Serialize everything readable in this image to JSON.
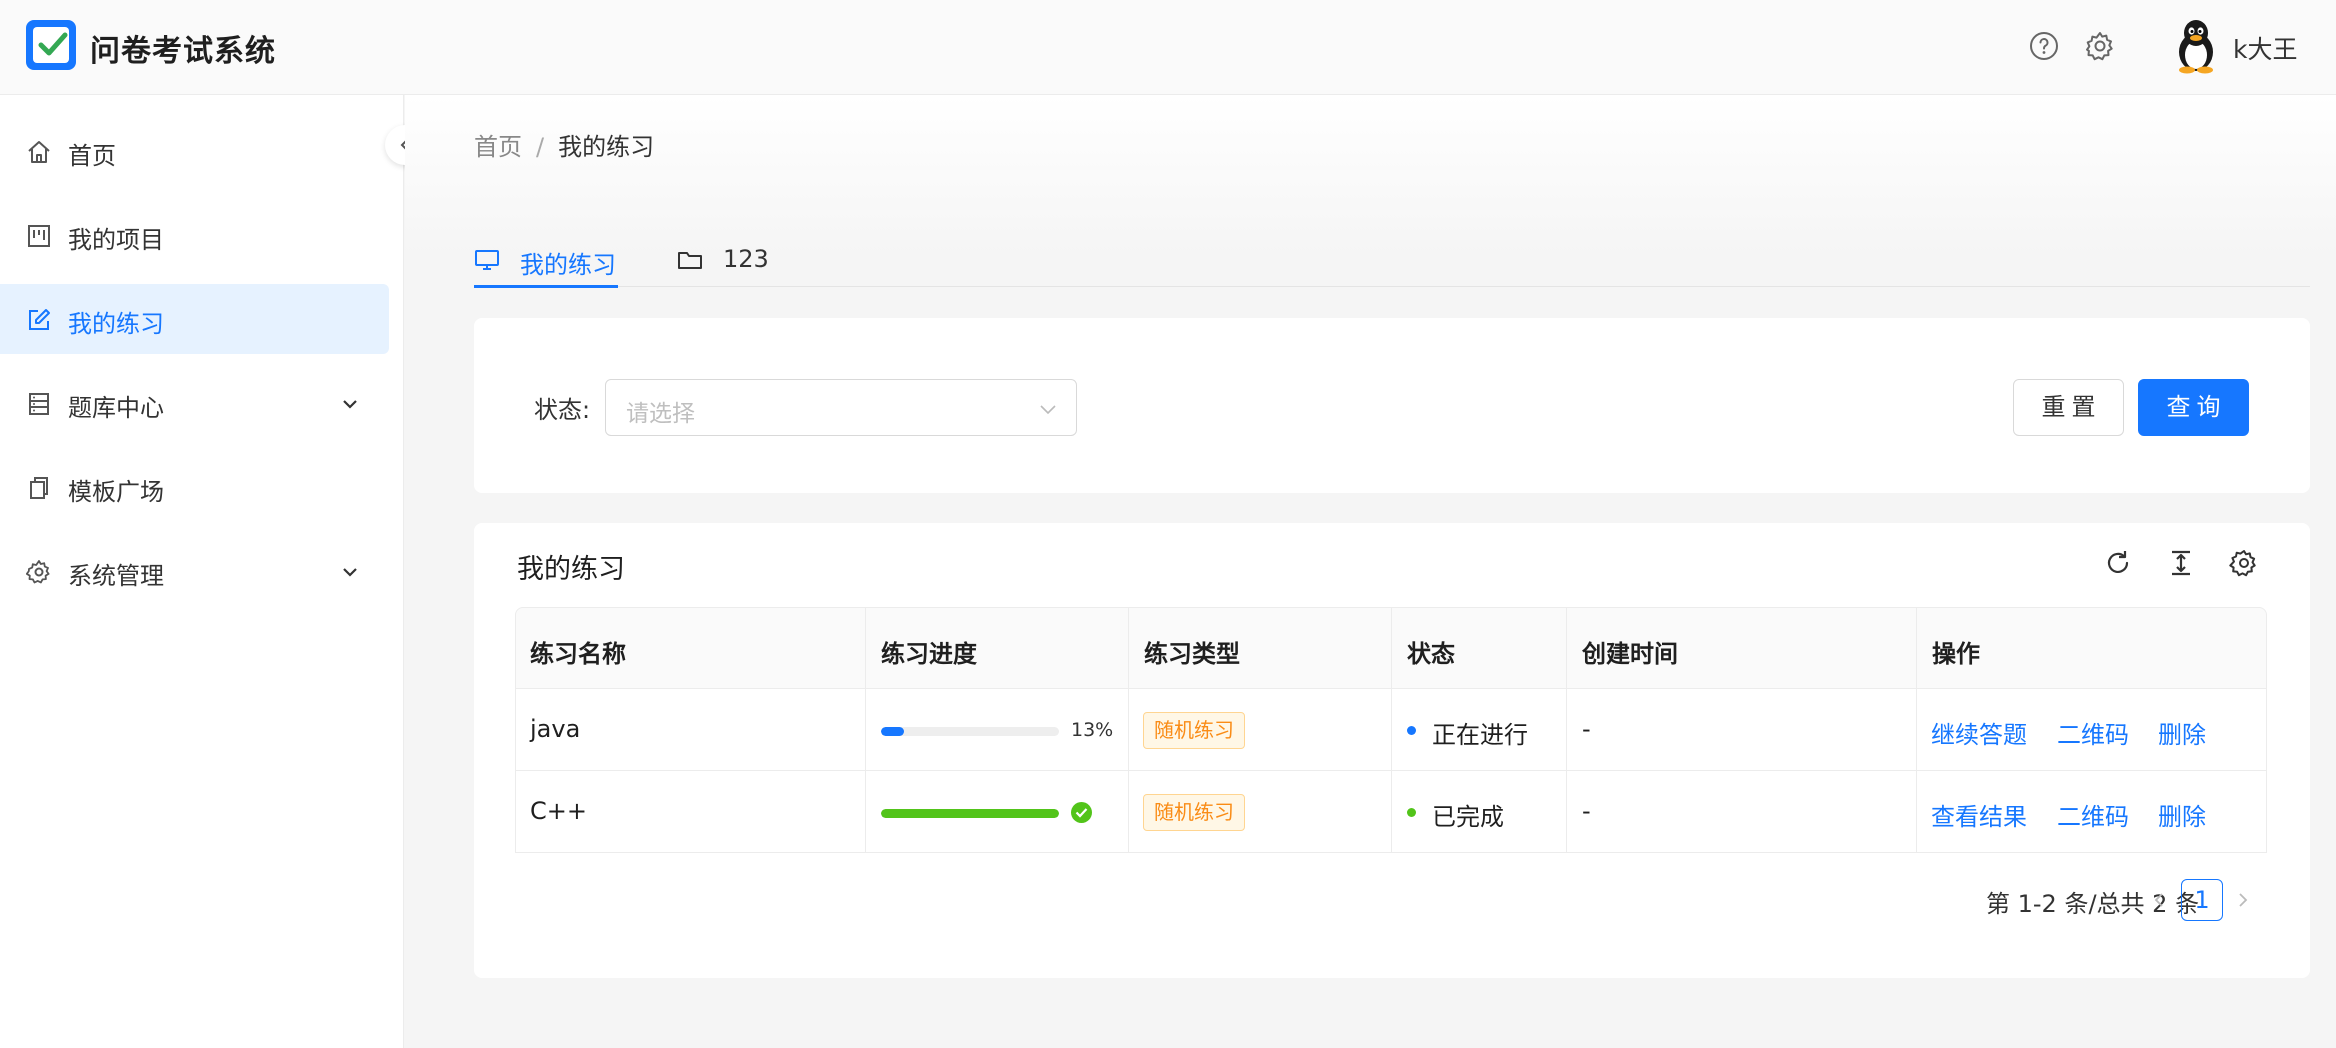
{
  "app": {
    "title": "问卷考试系统"
  },
  "header": {
    "username": "k大王",
    "icons": [
      "help-circle-icon",
      "gear-icon"
    ]
  },
  "sidebar": {
    "items": [
      {
        "label": "首页",
        "icon": "home-icon"
      },
      {
        "label": "我的项目",
        "icon": "project-icon"
      },
      {
        "label": "我的练习",
        "icon": "edit-icon",
        "active": true
      },
      {
        "label": "题库中心",
        "icon": "database-icon",
        "expandable": true
      },
      {
        "label": "模板广场",
        "icon": "copy-icon"
      },
      {
        "label": "系统管理",
        "icon": "gear-icon",
        "expandable": true
      }
    ]
  },
  "breadcrumb": {
    "home": "首页",
    "separator": "/",
    "current": "我的练习"
  },
  "tabs": [
    {
      "label": "我的练习",
      "icon": "desktop-icon",
      "active": true
    },
    {
      "label": "123",
      "icon": "folder-icon"
    }
  ],
  "filter": {
    "status_label": "状态:",
    "placeholder": "请选择",
    "reset_label": "重置",
    "query_label": "查询"
  },
  "table": {
    "title": "我的练习",
    "columns": [
      "练习名称",
      "练习进度",
      "练习类型",
      "状态",
      "创建时间",
      "操作"
    ],
    "rows": [
      {
        "name": "java",
        "progress": 13,
        "progress_text": "13%",
        "type": "随机练习",
        "status": "正在进行",
        "status_color": "#1677ff",
        "created": "-",
        "actions": [
          "继续答题",
          "二维码",
          "删除"
        ]
      },
      {
        "name": "C++",
        "progress": 100,
        "progress_text": "",
        "type": "随机练习",
        "status": "已完成",
        "status_color": "#52c41a",
        "created": "-",
        "actions": [
          "查看结果",
          "二维码",
          "删除"
        ]
      }
    ]
  },
  "pagination": {
    "total_text": "第 1-2 条/总共 2 条",
    "current_page": "1"
  },
  "colors": {
    "primary": "#1677ff",
    "success": "#52c41a",
    "warning": "#fa8c16"
  }
}
